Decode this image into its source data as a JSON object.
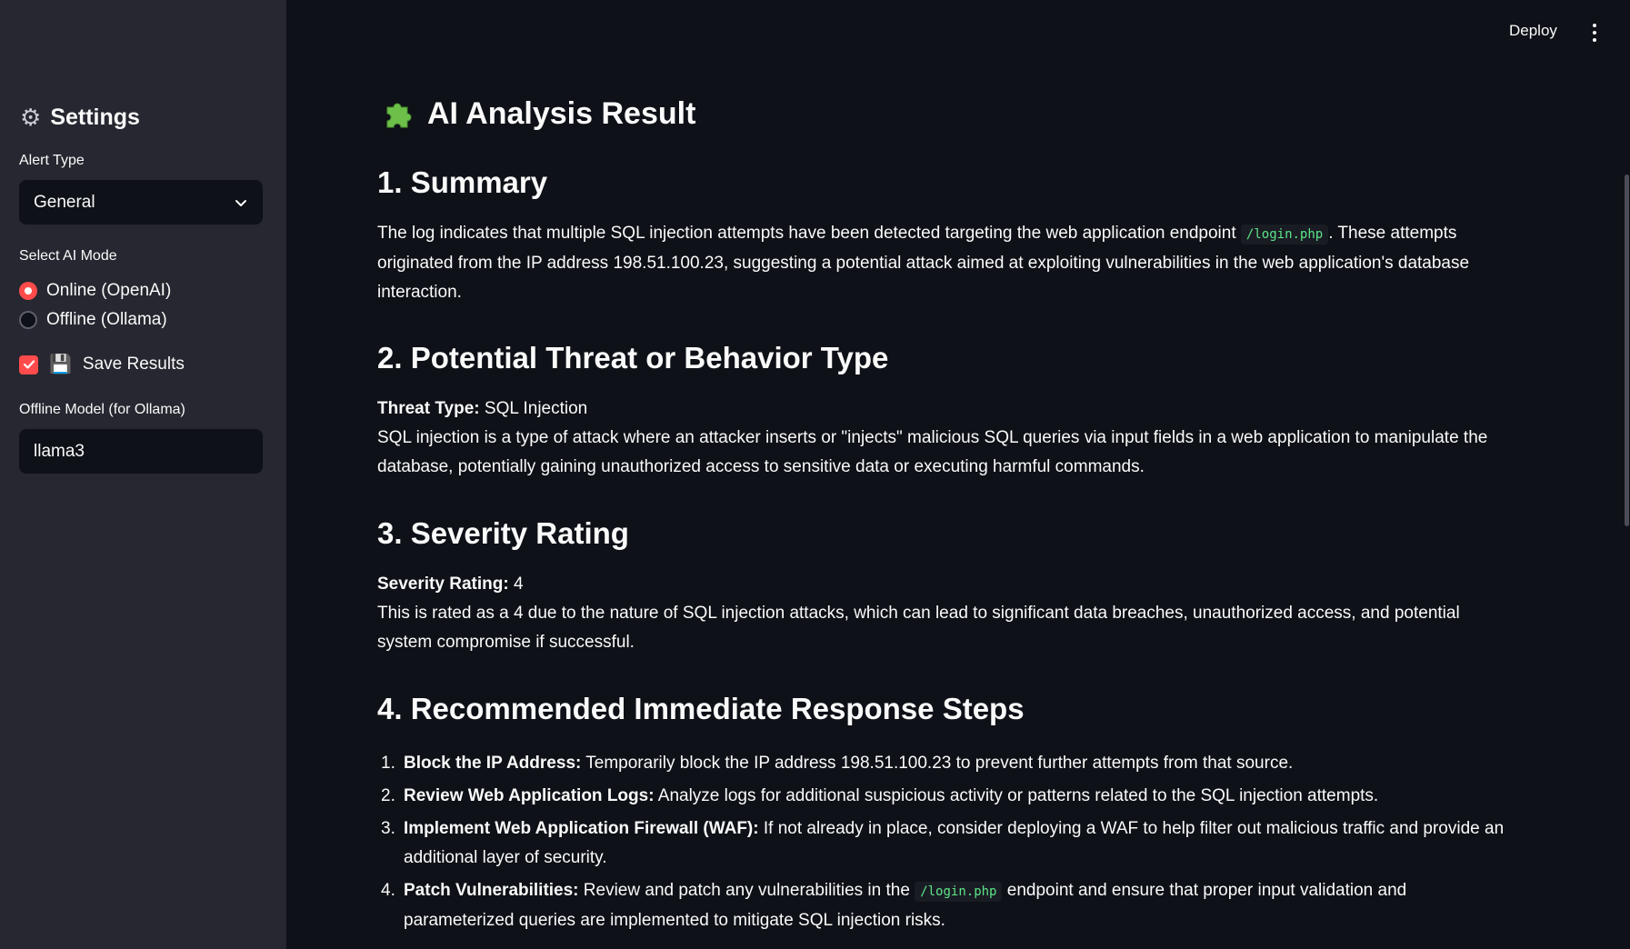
{
  "sidebar": {
    "title": "Settings",
    "alert_type_label": "Alert Type",
    "alert_type_value": "General",
    "ai_mode_label": "Select AI Mode",
    "ai_modes": [
      {
        "label": "Online (OpenAI)",
        "selected": true
      },
      {
        "label": "Offline (Ollama)",
        "selected": false
      }
    ],
    "save_results_label": "Save Results",
    "save_results_checked": true,
    "offline_model_label": "Offline Model (for Ollama)",
    "offline_model_value": "llama3"
  },
  "header": {
    "deploy_label": "Deploy"
  },
  "main": {
    "title": "AI Analysis Result",
    "summary": {
      "heading": "1. Summary",
      "text_before": "The log indicates that multiple SQL injection attempts have been detected targeting the web application endpoint",
      "code": "/login.php",
      "text_after": ". These attempts originated from the IP address 198.51.100.23, suggesting a potential attack aimed at exploiting vulnerabilities in the web application's database interaction."
    },
    "threat": {
      "heading": "2. Potential Threat or Behavior Type",
      "label": "Threat Type:",
      "value": "SQL Injection",
      "description": "SQL injection is a type of attack where an attacker inserts or \"injects\" malicious SQL queries via input fields in a web application to manipulate the database, potentially gaining unauthorized access to sensitive data or executing harmful commands."
    },
    "severity": {
      "heading": "3. Severity Rating",
      "label": "Severity Rating:",
      "value": "4",
      "description": "This is rated as a 4 due to the nature of SQL injection attacks, which can lead to significant data breaches, unauthorized access, and potential system compromise if successful."
    },
    "response": {
      "heading": "4. Recommended Immediate Response Steps",
      "steps": [
        {
          "num": "1.",
          "title": "Block the IP Address:",
          "text": "Temporarily block the IP address 198.51.100.23 to prevent further attempts from that source."
        },
        {
          "num": "2.",
          "title": "Review Web Application Logs:",
          "text": "Analyze logs for additional suspicious activity or patterns related to the SQL injection attempts."
        },
        {
          "num": "3.",
          "title": "Implement Web Application Firewall (WAF):",
          "text": "If not already in place, consider deploying a WAF to help filter out malicious traffic and provide an additional layer of security."
        },
        {
          "num": "4.",
          "title": "Patch Vulnerabilities:",
          "text_before": "Review and patch any vulnerabilities in the",
          "code": "/login.php",
          "text_after": "endpoint and ensure that proper input validation and parameterized queries are implemented to mitigate SQL injection risks."
        }
      ]
    }
  },
  "colors": {
    "background": "#0e1117",
    "sidebar": "#262730",
    "accent": "#ff4b4b",
    "code_text": "#5ce488"
  },
  "icons": {
    "settings": "gear-icon",
    "title": "puzzle-icon",
    "save": "floppy-disk-icon",
    "dropdown": "chevron-down-icon",
    "menu": "kebab-menu-icon"
  }
}
